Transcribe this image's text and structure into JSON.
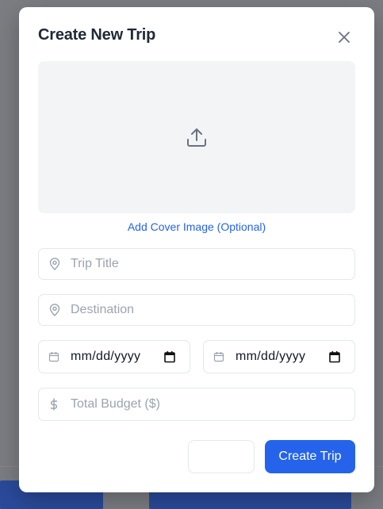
{
  "modal": {
    "title": "Create New Trip",
    "cover_image_label": "Add Cover Image (Optional)",
    "trip_title_placeholder": "Trip Title",
    "destination_placeholder": "Destination",
    "start_date": "mm/dd/yyyy",
    "end_date": "mm/dd/yyyy",
    "budget_placeholder": "Total Budget ($)",
    "cancel_label": "",
    "create_label": "Create Trip"
  },
  "icons": {
    "close": "close-icon",
    "upload": "upload-icon",
    "location": "map-pin-icon",
    "calendar": "calendar-icon",
    "dollar": "dollar-icon"
  },
  "colors": {
    "accent": "#2563eb",
    "upload_bg": "#f3f4f6",
    "border": "#e5e7eb",
    "placeholder": "#9ca3af"
  }
}
